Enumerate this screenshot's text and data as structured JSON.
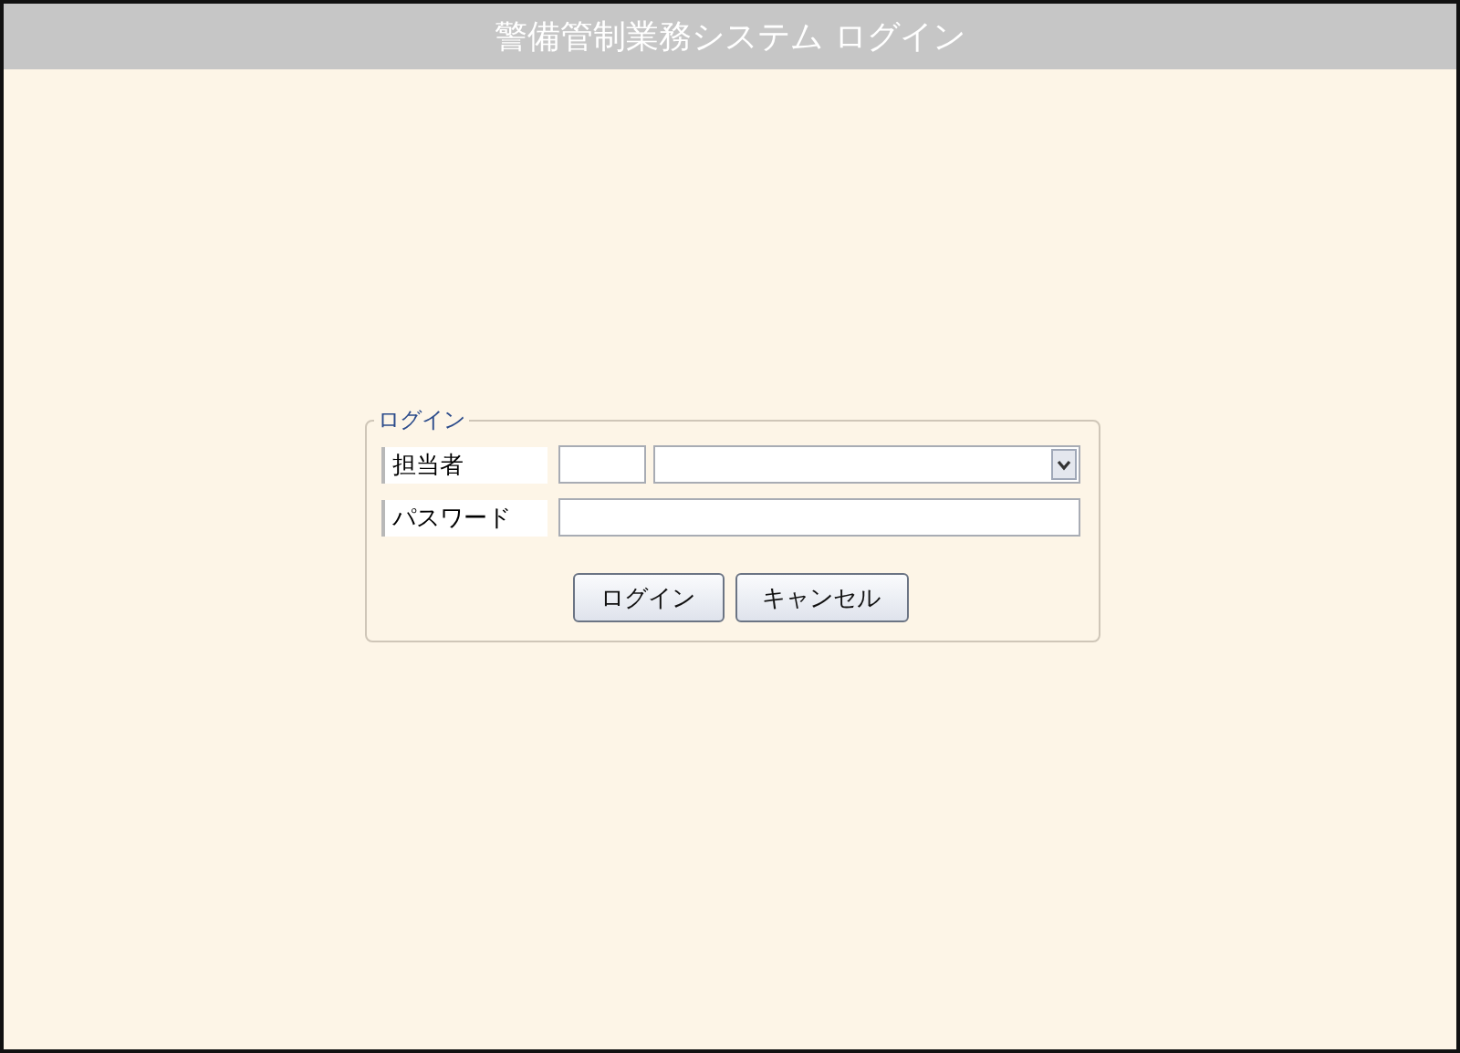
{
  "window": {
    "title": "警備管制業務システム ログイン"
  },
  "login_form": {
    "legend": "ログイン",
    "fields": [
      {
        "label": "担当者",
        "kind": "staff"
      },
      {
        "label": "パスワード",
        "kind": "password"
      }
    ],
    "buttons": [
      "ログイン",
      "キャンセル"
    ]
  }
}
